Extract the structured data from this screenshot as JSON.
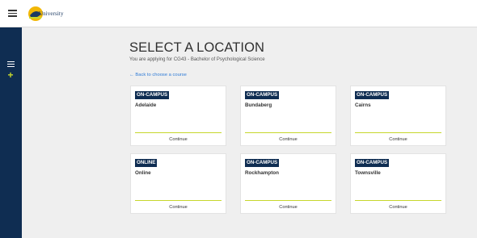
{
  "header": {
    "logo_text": "University"
  },
  "page": {
    "title": "SELECT A LOCATION",
    "subtitle": "You are applying for CG43 - Bachelor of Psychological Science",
    "back_link": "← Back to choose a course"
  },
  "locations": [
    {
      "badge": "ON-CAMPUS",
      "name": "Adelaide",
      "action": "Continue"
    },
    {
      "badge": "ON-CAMPUS",
      "name": "Bundaberg",
      "action": "Continue"
    },
    {
      "badge": "ON-CAMPUS",
      "name": "Cairns",
      "action": "Continue"
    },
    {
      "badge": "ONLINE",
      "name": "Online",
      "action": "Continue"
    },
    {
      "badge": "ON-CAMPUS",
      "name": "Rockhampton",
      "action": "Continue"
    },
    {
      "badge": "ON-CAMPUS",
      "name": "Townsville",
      "action": "Continue"
    }
  ],
  "colors": {
    "navy": "#0f2d52",
    "accent": "#c6d72c",
    "link": "#2f7bd6"
  },
  "icons": {
    "menu": "hamburger-icon",
    "sidebar_list": "list-icon",
    "sidebar_add": "plus-icon"
  }
}
